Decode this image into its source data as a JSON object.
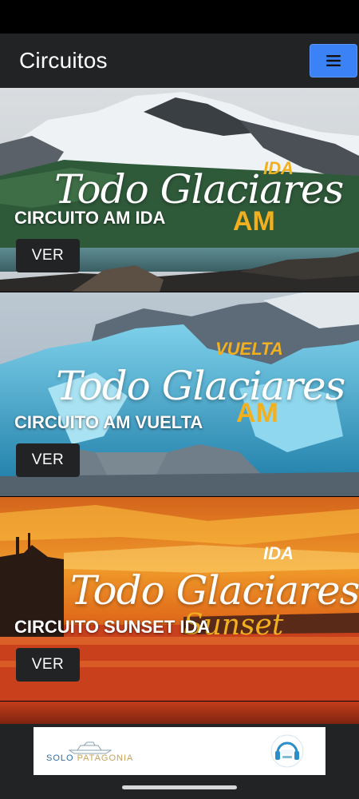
{
  "app_bar": {
    "title": "Circuitos",
    "menu_icon": "hamburger-menu-icon"
  },
  "cards": [
    {
      "title": "CIRCUITO AM IDA",
      "button_label": "VER",
      "brand_script": "Todo Glaciares",
      "brand_tag": "IDA",
      "brand_badge": "AM"
    },
    {
      "title": "CIRCUITO AM VUELTA",
      "button_label": "VER",
      "brand_script": "Todo Glaciares",
      "brand_tag": "VUELTA",
      "brand_badge": "AM"
    },
    {
      "title": "CIRCUITO SUNSET IDA",
      "button_label": "VER",
      "brand_script": "Todo Glaciares",
      "brand_tag": "IDA",
      "brand_badge": "Sunset"
    }
  ],
  "sponsor": {
    "left_name_part1": "SOLO",
    "left_name_part2": "PATAGONIA",
    "right_logo_icon": "headphones-logo-icon"
  },
  "colors": {
    "app_bar_bg": "#222325",
    "menu_button_bg": "#3b82f6",
    "accent_gold": "#f2b01e"
  }
}
